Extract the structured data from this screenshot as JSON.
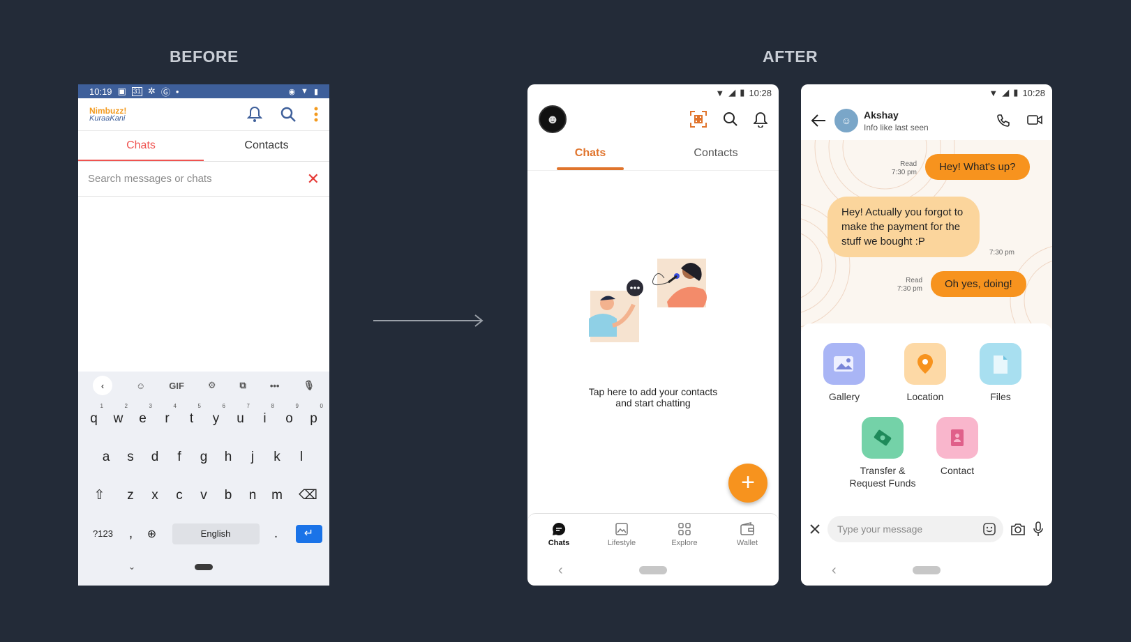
{
  "labels": {
    "before": "BEFORE",
    "after": "AFTER"
  },
  "before": {
    "status_time": "10:19",
    "status_date": "31",
    "logo_line1": "Nimbuzz!",
    "logo_line2": "KuraaKani",
    "tabs": [
      "Chats",
      "Contacts"
    ],
    "search_placeholder": "Search messages or chats",
    "close_glyph": "✕",
    "keyboard": {
      "gif": "GIF",
      "row1": [
        "q",
        "w",
        "e",
        "r",
        "t",
        "y",
        "u",
        "i",
        "o",
        "p"
      ],
      "row1_hints": [
        "1",
        "2",
        "3",
        "4",
        "5",
        "6",
        "7",
        "8",
        "9",
        "0"
      ],
      "row2": [
        "a",
        "s",
        "d",
        "f",
        "g",
        "h",
        "j",
        "k",
        "l"
      ],
      "row3": [
        "z",
        "x",
        "c",
        "v",
        "b",
        "n",
        "m"
      ],
      "symbols_key": "?123",
      "comma": ",",
      "period": ".",
      "space_label": "English"
    }
  },
  "after_home": {
    "status_time": "10:28",
    "tabs": [
      "Chats",
      "Contacts"
    ],
    "empty_line1": "Tap here to add your contacts",
    "empty_line2": "and start chatting",
    "fab": "+",
    "bottom_nav": [
      "Chats",
      "Lifestyle",
      "Explore",
      "Wallet"
    ]
  },
  "after_chat": {
    "status_time": "10:28",
    "contact_name": "Akshay",
    "contact_status": "Info like last seen",
    "messages": [
      {
        "text": "Hey! What's up?",
        "status": "Read",
        "time": "7:30 pm"
      },
      {
        "text": "Hey! Actually you forgot to make the payment for the stuff we bought :P",
        "time": "7:30 pm"
      },
      {
        "text": "Oh yes, doing!",
        "status": "Read",
        "time": "7:30 pm"
      }
    ],
    "attachments": [
      "Gallery",
      "Location",
      "Files",
      "Transfer & Request Funds",
      "Contact"
    ],
    "input_placeholder": "Type your message"
  },
  "colors": {
    "accent": "#f7931e",
    "accent_dark": "#e0742c",
    "background": "#232b38",
    "before_red": "#ef5350"
  }
}
